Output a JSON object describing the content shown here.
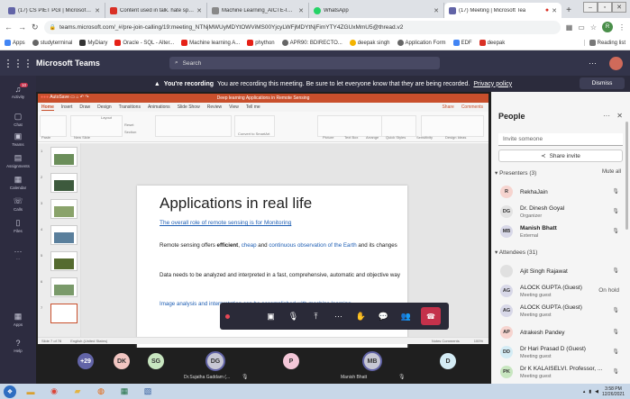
{
  "browser": {
    "tabs": [
      {
        "title": "(17) CS PIET PGI | Microsoft Tea",
        "color": "#6264a7"
      },
      {
        "title": "Content used in talk. hate speec",
        "color": "#d93025"
      },
      {
        "title": "Machine Learning_AICTE-ISTE -",
        "color": "#888"
      },
      {
        "title": "WhatsApp",
        "color": "#25d366"
      },
      {
        "title": "(17) Meeting | Microsoft Tea",
        "color": "#6264a7"
      }
    ],
    "new_tab": "+",
    "url": "teams.microsoft.com/_#/pre-join-calling/19:meeting_NTNjMWUyMDYtOWViMS00YjcyLWFjMDYtNjFimYTY4ZGUxMmU5@thread.v2",
    "profile_initial": "R",
    "bookmarks": [
      "Apps",
      "studyterminal",
      "MyDiary",
      "Oracle - SQL - Alter...",
      "Machine learning A...",
      "phython",
      "APR90: BDIRECTO...",
      "deepak singh",
      "Application Form",
      "EDF",
      "deepak"
    ],
    "reading_list": "Reading list"
  },
  "teams": {
    "app_name": "Microsoft Teams",
    "search_placeholder": "Search",
    "more": "···",
    "rail": [
      {
        "label": "Activity",
        "icon": "bell-icon",
        "badge": "10"
      },
      {
        "label": "Chat",
        "icon": "chat-icon"
      },
      {
        "label": "Teams",
        "icon": "teams-icon"
      },
      {
        "label": "Assignments",
        "icon": "assignments-icon"
      },
      {
        "label": "Calendar",
        "icon": "calendar-icon"
      },
      {
        "label": "Calls",
        "icon": "phone-icon"
      },
      {
        "label": "Files",
        "icon": "files-icon"
      },
      {
        "label": "···",
        "icon": "more-icon"
      },
      {
        "label": "Apps",
        "icon": "apps-icon"
      },
      {
        "label": "Help",
        "icon": "help-icon"
      }
    ],
    "banner": {
      "bold": "You're recording",
      "text": "You are recording this meeting. Be sure to let everyone know that they are being recorded.",
      "link": "Privacy policy",
      "dismiss": "Dismiss"
    }
  },
  "ppt": {
    "window_title": "Deep learning Applications in Remote Sensing",
    "qat": "AutoSave",
    "menu": [
      "Home",
      "Insert",
      "Draw",
      "Design",
      "Transitions",
      "Animations",
      "Slide Show",
      "Review",
      "View",
      "Tell me"
    ],
    "share": "Share",
    "comments": "Comments",
    "ribbon_groups": [
      "Paste",
      "New Slide",
      "Layout",
      "Reset",
      "Section",
      "Convert to SmartArt",
      "Picture",
      "Text Box",
      "Arrange",
      "Quick Styles",
      "Sensitivity",
      "Design Ideas"
    ],
    "thumb_numbers": [
      "1",
      "2",
      "3",
      "4",
      "5",
      "6",
      "7"
    ],
    "slide": {
      "title": "Applications in real life",
      "subtitle": "The overall role of remote sensing is for Monitoring",
      "p1_a": "Remote sensing offers ",
      "p1_b": "efficient",
      "p1_c": ", ",
      "p1_d": "cheap",
      "p1_e": " and ",
      "p1_f": "continuous observation of the Earth",
      "p1_g": " and its changes",
      "p2": "Data needs to be analyzed and interpreted in a fast, comprehensive, automatic and objective way",
      "p3": "Image analysis and interpretation can be accomplished with machine learning"
    },
    "status_left": "Slide 7 of 78",
    "status_lang": "English (United States)",
    "status_right": "Notes    Comments",
    "zoom": "100%"
  },
  "call": {
    "elapsed": "",
    "controls": [
      "video-off-icon",
      "mic-off-icon",
      "share-screen-icon",
      "more-icon",
      "raise-hand-icon",
      "chat-icon",
      "participants-icon"
    ]
  },
  "stage_participants": [
    {
      "initials": "+29",
      "color": "#6264a7",
      "text": "#fff"
    },
    {
      "initials": "DK",
      "color": "#f2c6c2",
      "text": "#333"
    },
    {
      "initials": "SG",
      "color": "#c8e6c0",
      "text": "#333"
    },
    {
      "initials": "DG",
      "color": "#c7c7d4",
      "text": "#333",
      "name": "Dr.Sujatha Gaddam (..."
    },
    {
      "initials": "P",
      "color": "#f4c7d8",
      "text": "#333"
    },
    {
      "initials": "MB",
      "color": "#c7c7d4",
      "text": "#333",
      "name": "Manish Bhatt"
    },
    {
      "initials": "D",
      "color": "#d4ecf5",
      "text": "#333"
    }
  ],
  "people": {
    "title": "People",
    "invite_placeholder": "Invite someone",
    "share_invite": "Share invite",
    "presenters_label": "Presenters (3)",
    "mute_all": "Mute all",
    "presenters": [
      {
        "initials": "R",
        "color": "#f6d4cf",
        "name": "RekhaJain",
        "sub": ""
      },
      {
        "initials": "DG",
        "color": "#e3e3e3",
        "name": "Dr. Dinesh Goyal",
        "sub": "Organizer"
      },
      {
        "initials": "MB",
        "color": "#d8d8e8",
        "name": "Manish Bhatt",
        "sub": "External",
        "bold": true
      }
    ],
    "attendees_label": "Attendees (31)",
    "attendees": [
      {
        "initials": "",
        "color": "#e0e0e0",
        "name": "Ajit Singh Rajawat",
        "sub": "",
        "action": "mic-off"
      },
      {
        "initials": "AG",
        "color": "#d8d8e8",
        "name": "ALOCK GUPTA (Guest)",
        "sub": "Meeting guest",
        "action": "On hold"
      },
      {
        "initials": "AG",
        "color": "#d8d8e8",
        "name": "ALOCK GUPTA (Guest)",
        "sub": "Meeting guest",
        "action": "mic-off"
      },
      {
        "initials": "AP",
        "color": "#f6d4cf",
        "name": "Atrakesh Pandey",
        "sub": "",
        "action": "mic-off"
      },
      {
        "initials": "DD",
        "color": "#d4ecf5",
        "name": "Dr Hari Prasad D (Guest)",
        "sub": "Meeting guest",
        "action": "mic-off"
      },
      {
        "initials": "PK",
        "color": "#c8e6c0",
        "name": "Dr K KALAISELVI. Professor, ...",
        "sub": "Meeting guest",
        "action": "mic-off"
      }
    ]
  },
  "taskbar": {
    "time": "3:58 PM",
    "date": "12/26/2021"
  }
}
